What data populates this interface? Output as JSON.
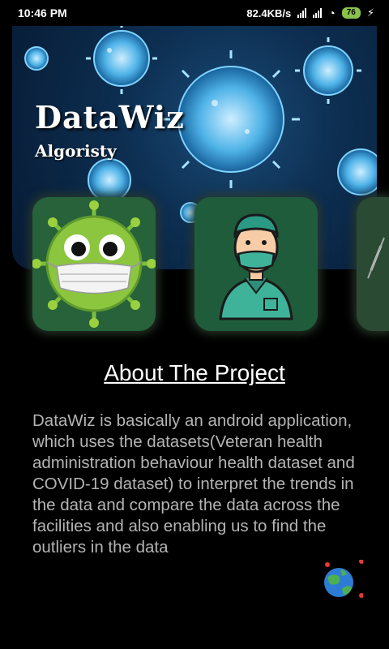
{
  "status_bar": {
    "time": "10:46 PM",
    "speed": "82.4KB/s",
    "battery": "76"
  },
  "header": {
    "app_title": "DataWiz",
    "subtitle": "Algoristy"
  },
  "cards": [
    {
      "icon": "masked-virus-icon"
    },
    {
      "icon": "doctor-icon"
    },
    {
      "icon": "partial-card"
    }
  ],
  "about": {
    "title": "About The Project",
    "body": "DataWiz is basically an android application, which uses the datasets(Veteran health administration behaviour health dataset and COVID-19 dataset) to interpret the trends in the data and compare the data across the facilities and also enabling us to find the outliers in the data"
  },
  "colors": {
    "background": "#000000",
    "card_green": "#27623a",
    "banner_blue": "#0d2f52",
    "text_gray": "#b4b4b4"
  }
}
